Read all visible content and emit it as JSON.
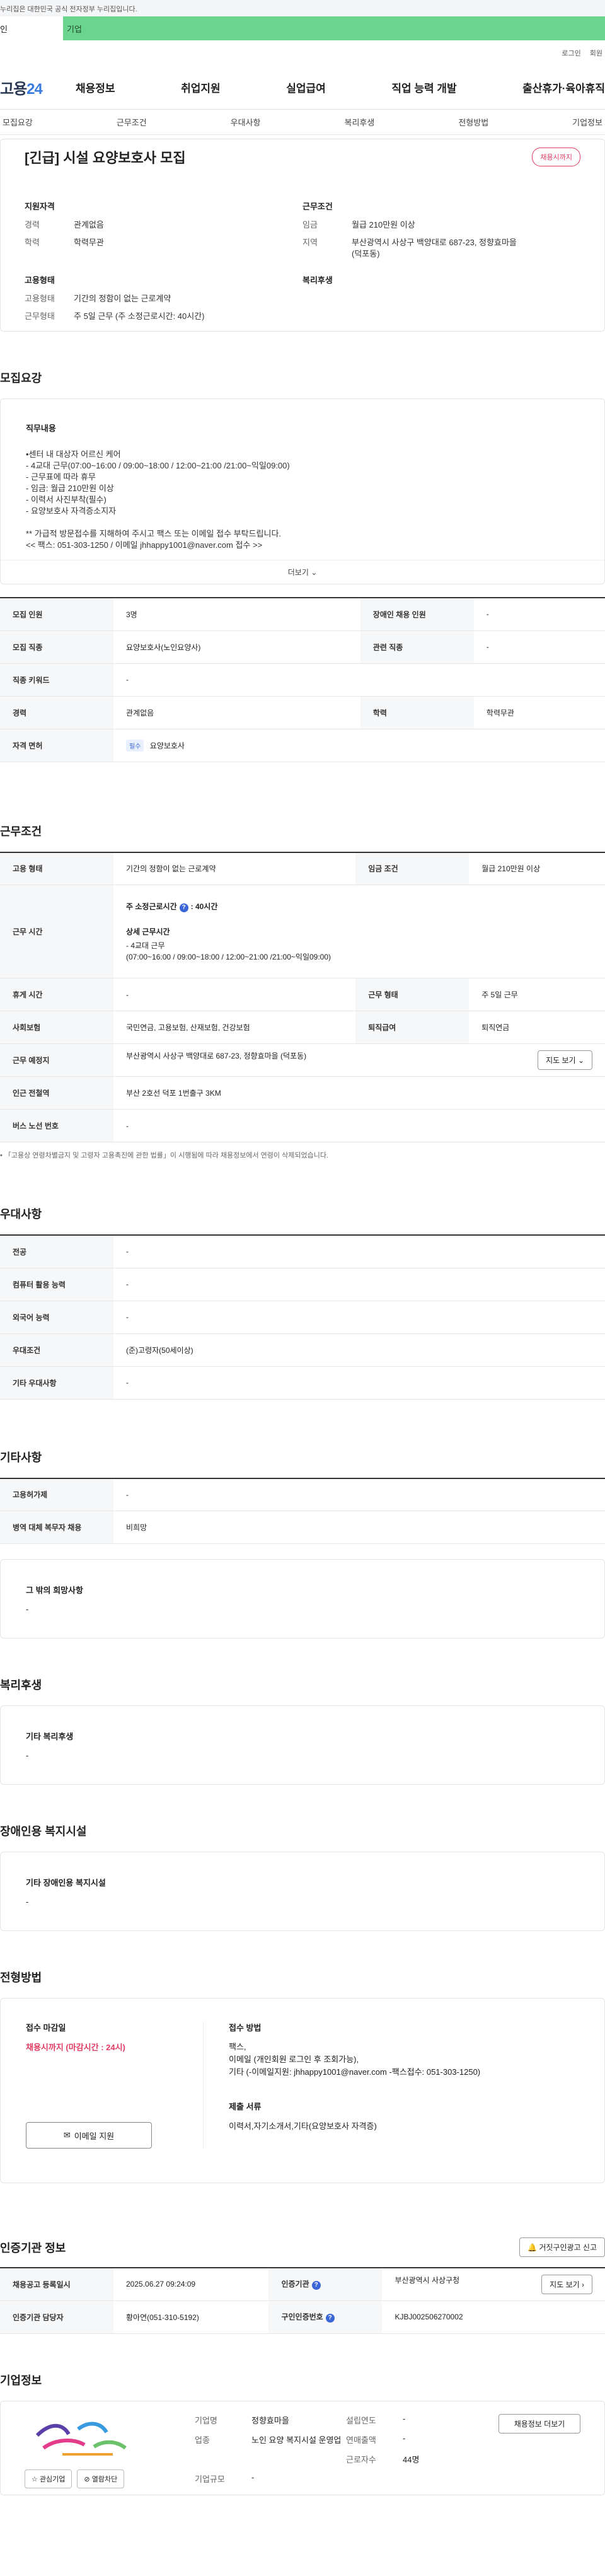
{
  "gov_notice": "누리집은 대한민국 공식 전자정부 누리집입니다.",
  "role_tabs": [
    "인",
    "기업"
  ],
  "util_links": [
    "로그인",
    "회원"
  ],
  "logo": {
    "text_a": "고용",
    "text_b": "24"
  },
  "gnb": [
    "채용정보",
    "취업지원",
    "실업급여",
    "직업 능력 개발",
    "출산휴가·육아휴직"
  ],
  "anchor_nav": [
    "모집요강",
    "근무조건",
    "우대사항",
    "복리후생",
    "전형방법",
    "기업정보"
  ],
  "job": {
    "title": "[긴급] 시설 요양보호사 모집",
    "status_badge": "채용시까지",
    "summary": {
      "qual_title": "지원자격",
      "qual": [
        {
          "k": "경력",
          "v": "관계없음"
        },
        {
          "k": "학력",
          "v": "학력무관"
        }
      ],
      "cond_title": "근무조건",
      "cond": [
        {
          "k": "임금",
          "v": "월급 210만원 이상"
        },
        {
          "k": "지역",
          "v": "부산광역시 사상구 백양대로 687-23, 정향효마을 (덕포동)"
        }
      ],
      "emp_title": "고용형태",
      "emp": [
        {
          "k": "고용형태",
          "v": "기간의 정함이 없는 근로계약"
        },
        {
          "k": "근무형태",
          "v": "주 5일 근무 (주 소정근로시간: 40시간)"
        }
      ],
      "welfare_title": "복리후생"
    }
  },
  "recruit": {
    "section_title": "모집요강",
    "detail_title": "직무내용",
    "detail_text": "•센터 내 대상자 어르신 케어\n - 4교대 근무(07:00~16:00 / 09:00~18:00 / 12:00~21:00 /21:00~익일09:00)\n - 근무표에 따라 휴무\n - 임금: 월급 210만원 이상\n - 이력서 사진부착(필수)\n - 요양보호사 자격증소지자\n\n** 가급적 방문접수를 지해하여 주시고 팩스 또는 이메일 접수 부탁드립니다.\n << 팩스: 051-303-1250 / 이메일 jhhappy1001@naver.com 접수 >>",
    "more": "더보기",
    "rows": [
      {
        "k1": "모집 인원",
        "v1": "3명",
        "k2": "장애인 채용 인원",
        "v2": "-"
      },
      {
        "k1": "모집 직종",
        "v1": "요양보호사(노인요양사)",
        "k2": "관련 직종",
        "v2": "-"
      },
      {
        "k1": "직종 키워드",
        "v1": "-"
      },
      {
        "k1": "경력",
        "v1": "관계없음",
        "k2": "학력",
        "v2": "학력무관"
      },
      {
        "k1": "자격 면허",
        "tag": "필수",
        "v1": "요양보호사"
      }
    ]
  },
  "work": {
    "section_title": "근무조건",
    "emp_k": "고용 형태",
    "emp_v": "기간의 정함이 없는 근로계약",
    "wage_k": "임금 조건",
    "wage_v": "월급 210만원 이상",
    "time_k": "근무 시간",
    "time_weekly": "주 소정근로시간",
    "time_weekly_v": ": 40시간",
    "time_detail_title": "상세 근무시간",
    "time_detail_1": "- 4교대 근무",
    "time_detail_2": "(07:00~16:00 / 09:00~18:00 / 12:00~21:00 /21:00~익일09:00)",
    "rest_k": "휴게 시간",
    "rest_v": "-",
    "form_k": "근무 형태",
    "form_v": "주 5일 근무",
    "ins_k": "사회보험",
    "ins_v": "국민연금, 고용보험, 산재보험, 건강보험",
    "ret_k": "퇴직급여",
    "ret_v": "퇴직연금",
    "place_k": "근무 예정지",
    "place_v": "부산광역시 사상구 백양대로 687-23, 정향효마을 (덕포동)",
    "map_btn": "지도 보기",
    "subway_k": "인근 전철역",
    "subway_v": "부산 2호선 덕포 1번출구 3KM",
    "bus_k": "버스 노선 번호",
    "bus_v": "-",
    "note": "「고용상 연령차별금지 및 고령자 고용촉진에 관한 법률」이 시행됨에 따라 채용정보에서 연령이 삭제되었습니다."
  },
  "prefer": {
    "section_title": "우대사항",
    "rows": [
      {
        "k": "전공",
        "v": "-"
      },
      {
        "k": "컴퓨터 활용 능력",
        "v": "-"
      },
      {
        "k": "외국어 능력",
        "v": "-"
      },
      {
        "k": "우대조건",
        "v": "(준)고령자(50세이상)"
      },
      {
        "k": "기타 우대사항",
        "v": "-"
      }
    ]
  },
  "etc": {
    "section_title": "기타사항",
    "rows": [
      {
        "k": "고용허가제",
        "v": "-"
      },
      {
        "k": "병역 대체 복무자 채용",
        "v": "비희망"
      }
    ],
    "wish_title": "그 밖의 희망사항",
    "wish_v": "-"
  },
  "welfare": {
    "section_title": "복리후생",
    "box_title": "기타 복리후생",
    "box_v": "-"
  },
  "disabled": {
    "section_title": "장애인용 복지시설",
    "box_title": "기타 장애인용 복지시설",
    "box_v": "-"
  },
  "process": {
    "section_title": "전형방법",
    "deadline_title": "접수 마감일",
    "deadline_v": "채용시까지 (마감시간 : 24시)",
    "method_title": "접수 방법",
    "method_1": "팩스,",
    "method_2": "이메일 (개인회원 로그인 후 조회가능),",
    "method_3": "기타 (-이메일지원: jhhappy1001@naver.com -팩스접수: 051-303-1250)",
    "docs_title": "제출 서류",
    "docs_v": "이력서,자기소개서,기타(요양보호사 자격증)",
    "email_btn": "이메일 지원"
  },
  "cert": {
    "section_title": "인증기관 정보",
    "notify_btn": "거짓구인광고 신고",
    "reg_k": "채용공고 등록일시",
    "reg_v": "2025.06.27 09:24:09",
    "org_k": "인증기관",
    "org_v": "부산광역시 사상구청",
    "map_btn": "지도 보기",
    "mgr_k": "인증기관 담당자",
    "mgr_v": "황아연(051-310-5192)",
    "num_k": "구인인증번호",
    "num_v": "KJBJ002506270002"
  },
  "company": {
    "section_title": "기업정보",
    "fav_btn": "관심기업",
    "block_btn": "열람차단",
    "rows": [
      {
        "k1": "기업명",
        "v1": "정향효마을",
        "k2": "설립연도",
        "v2": "-"
      },
      {
        "k1": "업종",
        "v1": "노인 요양 복지시설 운영업",
        "k2": "연매출액",
        "v2": "-"
      },
      {
        "k1": "",
        "v1": "",
        "k2": "근로자수",
        "v2": "44명"
      },
      {
        "k1": "기업규모",
        "v1": "-",
        "k2": "",
        "v2": ""
      }
    ],
    "list_btn": "채용정보 더보기"
  }
}
